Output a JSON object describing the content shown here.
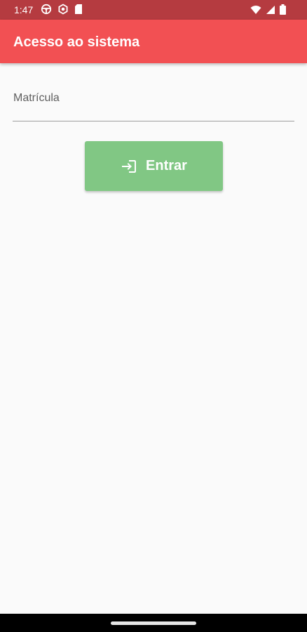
{
  "status_bar": {
    "time": "1:47",
    "left_icons": [
      "steering-wheel-icon",
      "settings-icon",
      "sim-card-icon"
    ],
    "right_icons": [
      "wifi-icon",
      "cellular-signal-icon",
      "battery-icon"
    ]
  },
  "app_bar": {
    "title": "Acesso ao sistema",
    "color": "#f25053"
  },
  "form": {
    "matricula_label": "Matrícula",
    "login_button_label": "Entrar",
    "login_button_icon": "login-icon",
    "login_button_color": "#81c784"
  }
}
